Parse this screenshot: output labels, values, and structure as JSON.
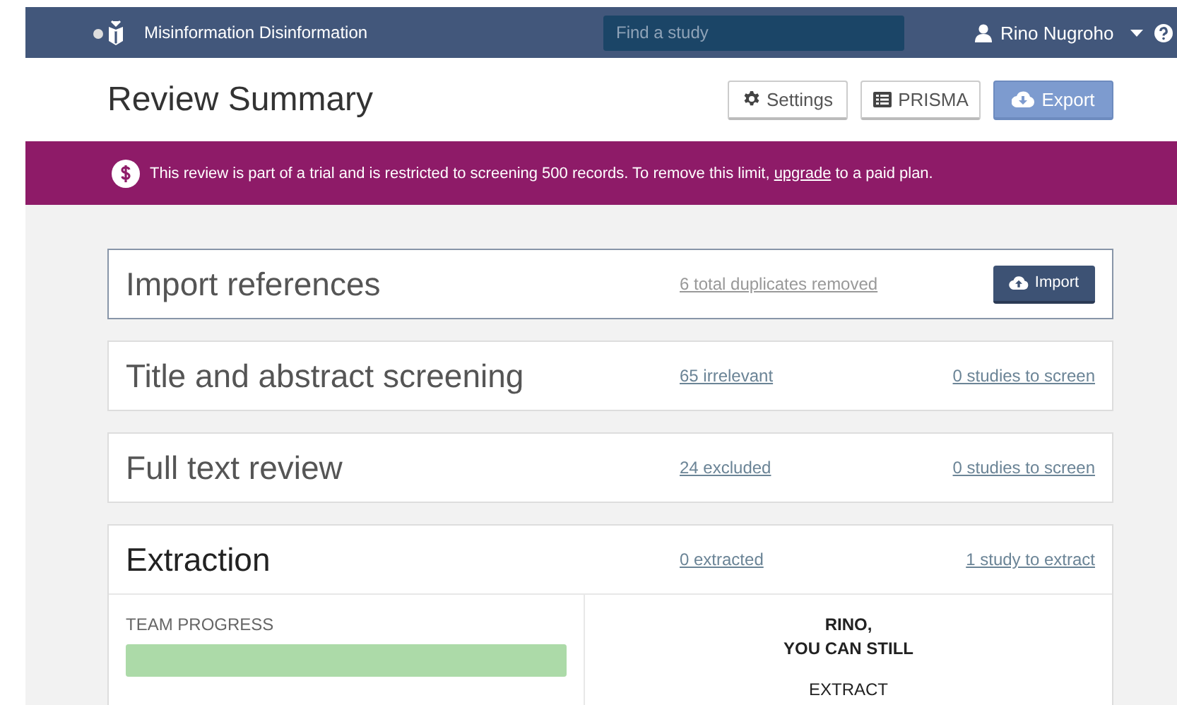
{
  "topbar": {
    "review_name": "Misinformation Disinformation",
    "search": {
      "placeholder": "Find a study"
    },
    "user": "Rino Nugroho"
  },
  "header": {
    "title": "Review Summary",
    "buttons": [
      {
        "label": "Settings",
        "kind": "settings",
        "primary": false
      },
      {
        "label": "PRISMA",
        "kind": "prisma",
        "primary": false
      },
      {
        "label": "Export",
        "kind": "export",
        "primary": true
      }
    ]
  },
  "banner": {
    "text": "This review is part of a trial and is restricted to screening 500 records. To remove this limit,",
    "link": "upgrade",
    "text_after": "to a paid plan."
  },
  "stages": [
    {
      "title": "Import references",
      "active": true,
      "links": [
        {
          "label": "6 total duplicates removed",
          "muted": true
        }
      ],
      "button": "Import"
    },
    {
      "title": "Title and abstract screening",
      "active": false,
      "links": [
        {
          "label": "65 irrelevant",
          "muted": false
        },
        {
          "label": "0 studies to screen",
          "muted": false
        }
      ]
    },
    {
      "title": "Full text review",
      "active": false,
      "links": [
        {
          "label": "24 excluded",
          "muted": false
        },
        {
          "label": "0 studies to screen",
          "muted": false
        }
      ]
    },
    {
      "title": "Extraction",
      "active": false,
      "links": [
        {
          "label": "0 extracted",
          "muted": false
        },
        {
          "label": "1 study to extract",
          "muted": false
        }
      ],
      "progress": {
        "label": "TEAM PROGRESS",
        "level": 1
      },
      "message": [
        "RINO,",
        "YOU CAN STILL",
        "EXTRACT"
      ]
    }
  ]
}
